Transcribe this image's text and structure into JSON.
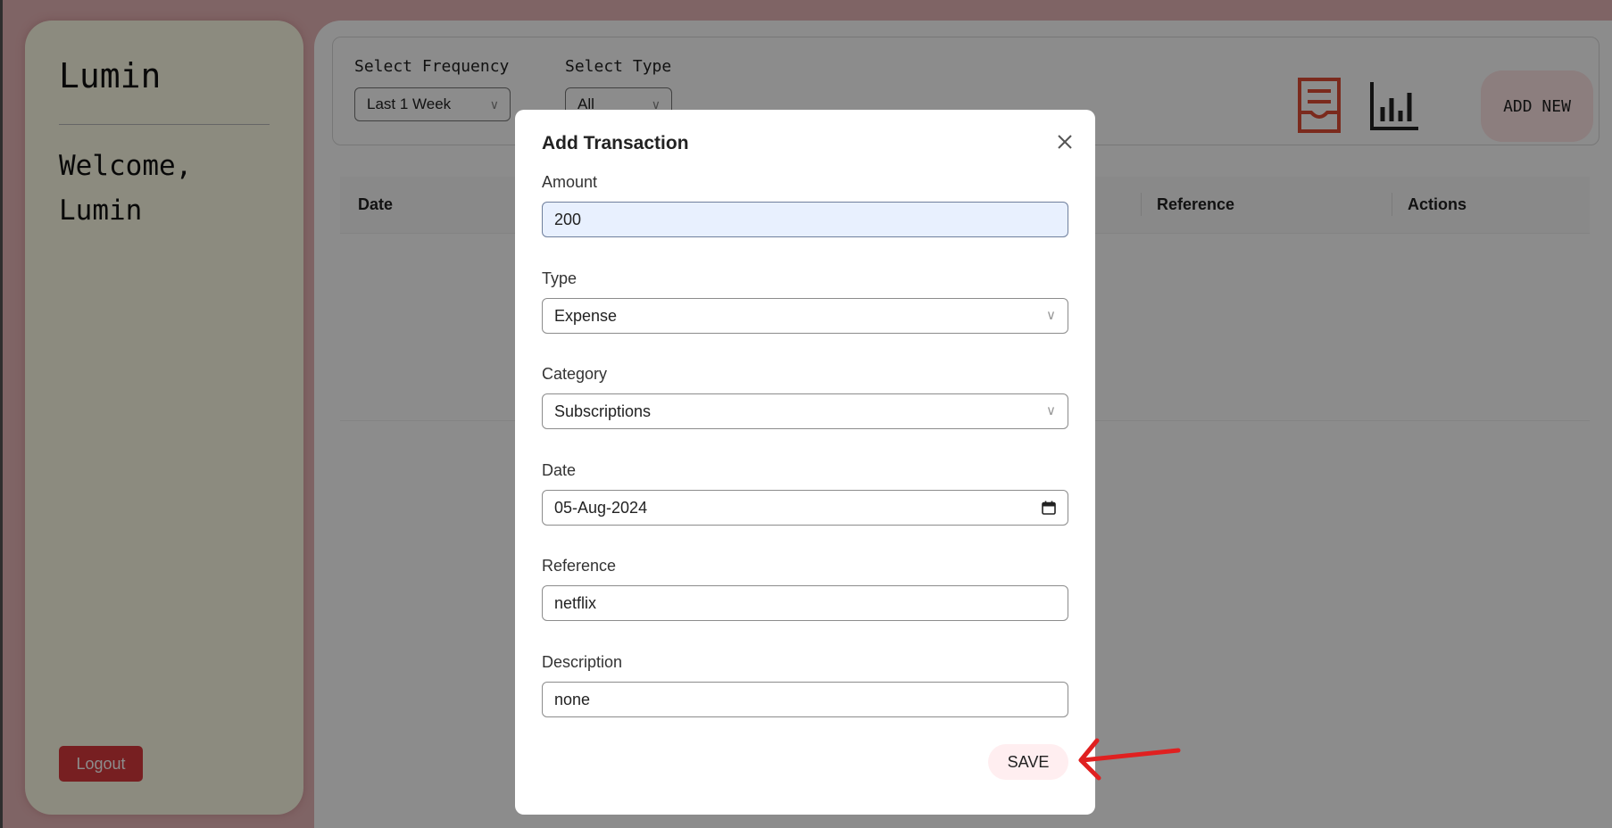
{
  "sidebar": {
    "brand": "Lumin",
    "welcome_line1": "Welcome,",
    "welcome_line2": "Lumin",
    "logout_label": "Logout"
  },
  "filters": {
    "frequency_label": "Select Frequency",
    "frequency_value": "Last 1 Week",
    "type_label": "Select Type",
    "type_value": "All"
  },
  "toolbar": {
    "report_icon": "report-list-icon",
    "chart_icon": "bar-chart-icon",
    "add_new_label": "ADD NEW"
  },
  "table": {
    "columns": [
      "Date",
      "Reference",
      "Actions"
    ]
  },
  "modal": {
    "title": "Add Transaction",
    "close_icon": "close-icon",
    "amount_label": "Amount",
    "amount_value": "200",
    "type_label": "Type",
    "type_value": "Expense",
    "category_label": "Category",
    "category_value": "Subscriptions",
    "date_label": "Date",
    "date_value": "05-Aug-2024",
    "reference_label": "Reference",
    "reference_value": "netflix",
    "description_label": "Description",
    "description_value": "none",
    "save_label": "SAVE"
  },
  "colors": {
    "page_background": "#e8b6b8",
    "sidebar_background": "#fffde8",
    "logout_red": "#d9393d",
    "report_icon_red": "#e04e36",
    "add_new_background": "#ffe6e6",
    "annotation_arrow": "#e02020",
    "amount_field_fill": "#e8f0fe"
  }
}
